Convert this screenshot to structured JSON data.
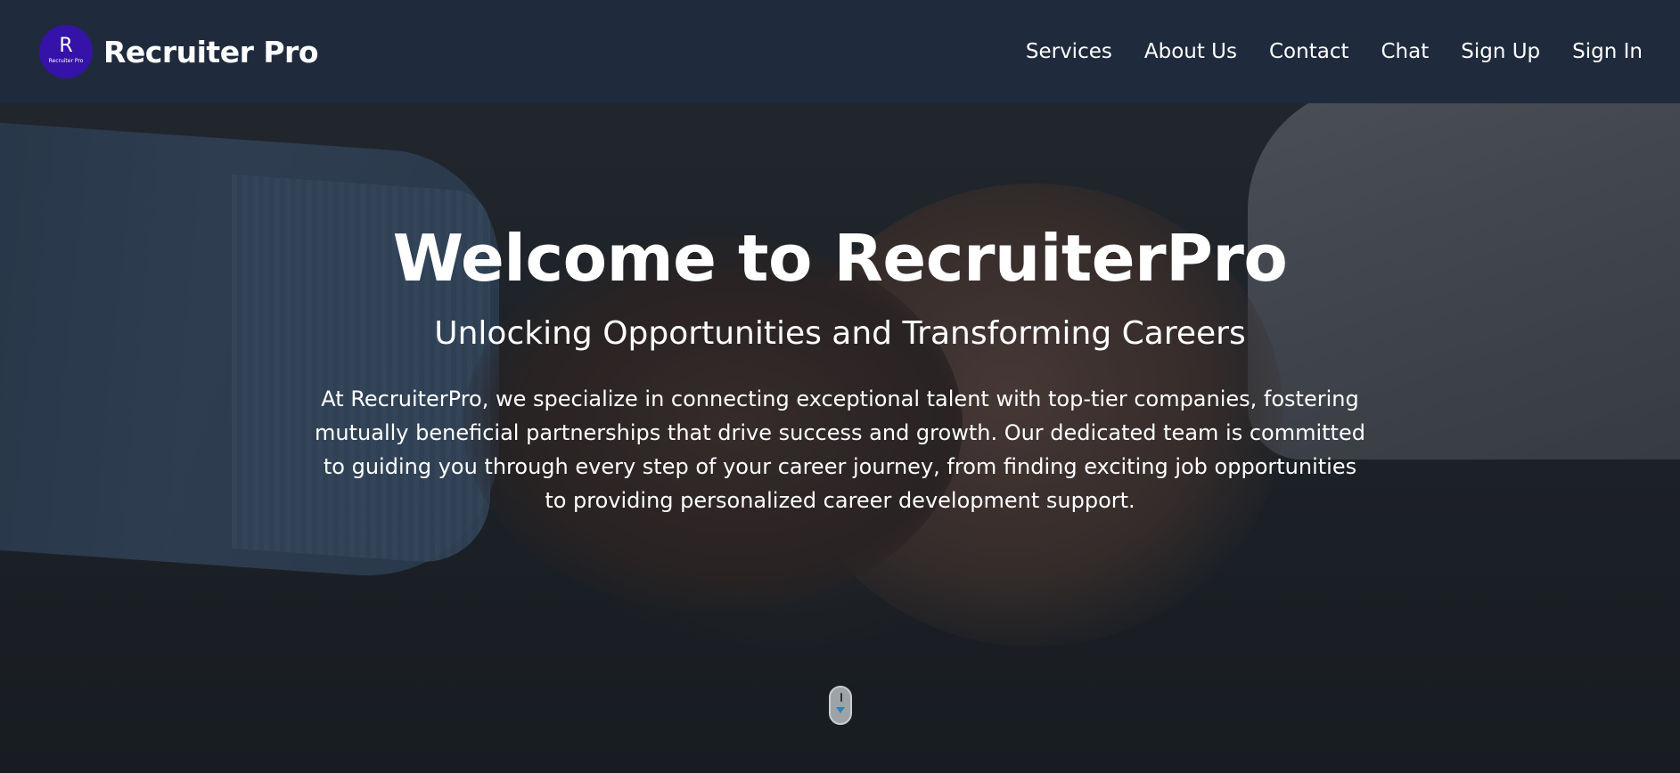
{
  "header": {
    "logo_letter": "R",
    "logo_caption": "Recruiter Pro",
    "brand_name": "Recruiter Pro",
    "nav": [
      {
        "label": "Services"
      },
      {
        "label": "About Us"
      },
      {
        "label": "Contact"
      },
      {
        "label": "Chat"
      },
      {
        "label": "Sign Up"
      },
      {
        "label": "Sign In"
      }
    ]
  },
  "hero": {
    "title": "Welcome to RecruiterPro",
    "subtitle": "Unlocking Opportunities and Transforming Careers",
    "description": "At RecruiterPro, we specialize in connecting exceptional talent with top-tier companies, fostering mutually beneficial partnerships that drive success and growth. Our dedicated team is committed to guiding you through every step of your career journey, from finding exciting job opportunities to providing personalized career development support.",
    "background_image": "handshake-photo",
    "scroll_indicator_icon": "scroll-down-mouse-icon"
  },
  "colors": {
    "header_bg": "#1f2a3d",
    "logo_bg": "#3513a8",
    "text": "#ffffff"
  }
}
